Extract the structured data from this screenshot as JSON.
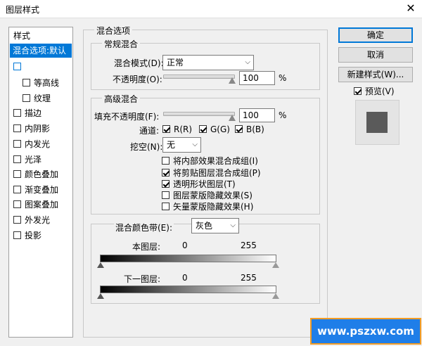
{
  "window": {
    "title": "图层样式",
    "close_glyph": "✕"
  },
  "sidebar": {
    "heading": "样式",
    "items": [
      {
        "label": "混合选项:默认",
        "has_checkbox": false,
        "selected": true
      },
      {
        "label": "",
        "has_checkbox": true,
        "checked": false
      },
      {
        "label": "等高线",
        "has_checkbox": true,
        "checked": false,
        "indent": true
      },
      {
        "label": "纹理",
        "has_checkbox": true,
        "checked": false,
        "indent": true
      },
      {
        "label": "描边",
        "has_checkbox": true,
        "checked": false
      },
      {
        "label": "内阴影",
        "has_checkbox": true,
        "checked": false
      },
      {
        "label": "内发光",
        "has_checkbox": true,
        "checked": false
      },
      {
        "label": "光泽",
        "has_checkbox": true,
        "checked": false
      },
      {
        "label": "颜色叠加",
        "has_checkbox": true,
        "checked": false
      },
      {
        "label": "渐变叠加",
        "has_checkbox": true,
        "checked": false
      },
      {
        "label": "图案叠加",
        "has_checkbox": true,
        "checked": false
      },
      {
        "label": "外发光",
        "has_checkbox": true,
        "checked": false
      },
      {
        "label": "投影",
        "has_checkbox": true,
        "checked": false
      }
    ]
  },
  "main": {
    "section_title": "混合选项",
    "general": {
      "title": "常规混合",
      "blend_mode_label": "混合模式(D):",
      "blend_mode_value": "正常",
      "opacity_label": "不透明度(O):",
      "opacity_value": "100",
      "opacity_unit": "%"
    },
    "advanced": {
      "title": "高级混合",
      "fill_opacity_label": "填充不透明度(F):",
      "fill_opacity_value": "100",
      "fill_opacity_unit": "%",
      "channels_label": "通道:",
      "channel_r": "R(R)",
      "channel_g": "G(G)",
      "channel_b": "B(B)",
      "knockout_label": "挖空(N):",
      "knockout_value": "无",
      "options": [
        {
          "label": "将内部效果混合成组(I)",
          "checked": false
        },
        {
          "label": "将剪贴图层混合成组(P)",
          "checked": true
        },
        {
          "label": "透明形状图层(T)",
          "checked": true
        },
        {
          "label": "图层蒙版隐藏效果(S)",
          "checked": false
        },
        {
          "label": "矢量蒙版隐藏效果(H)",
          "checked": false
        }
      ]
    },
    "blend_if": {
      "label": "混合颜色带(E):",
      "value": "灰色",
      "this_layer_label": "本图层:",
      "this_layer_low": "0",
      "this_layer_high": "255",
      "underlying_label": "下一图层:",
      "underlying_low": "0",
      "underlying_high": "255"
    }
  },
  "buttons": {
    "ok": "确定",
    "cancel": "取消",
    "new_style": "新建样式(W)...",
    "preview_label": "预览(V)"
  },
  "watermark": "www.pszxw.com"
}
